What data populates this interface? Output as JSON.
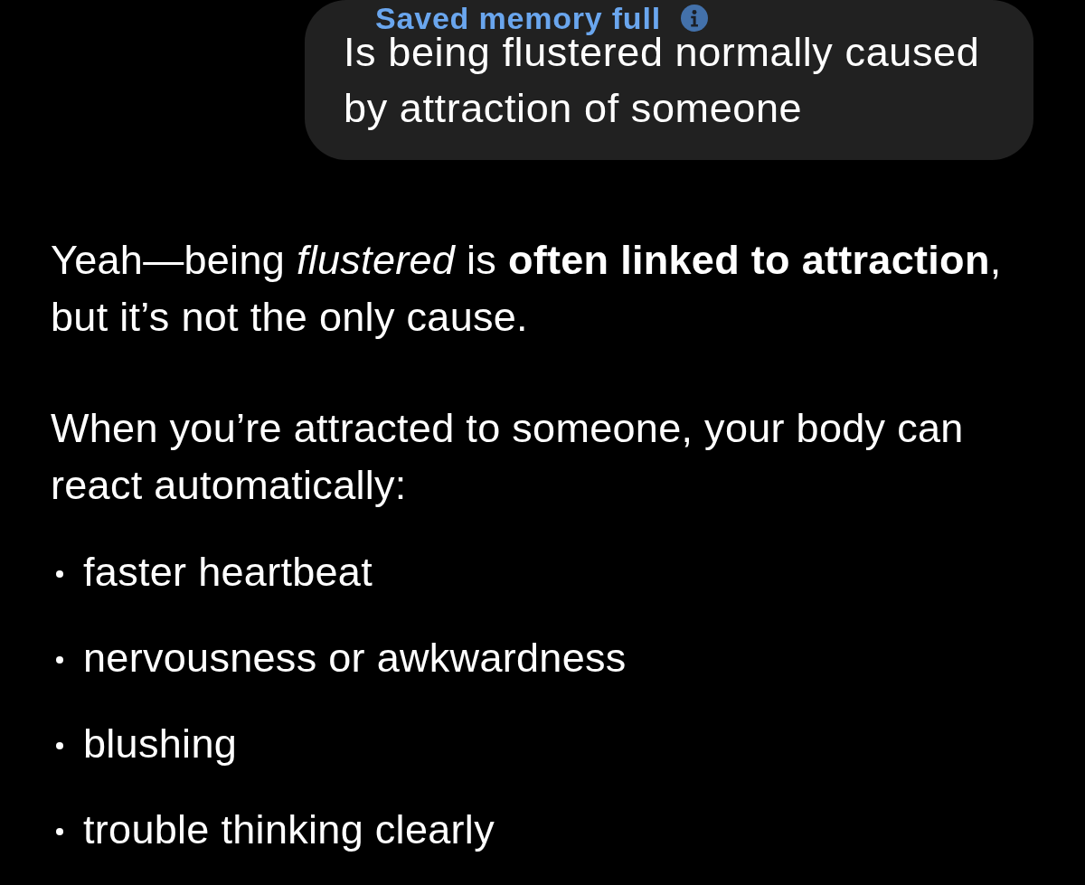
{
  "user_message": {
    "memory_notice": "Saved memory full",
    "text": "Is being flustered normally caused by attraction of someone"
  },
  "assistant_message": {
    "paragraphs": [
      "Yeah—being *flustered* is **often linked to attraction**, but it’s not the only cause.",
      "When you’re attracted to someone, your body can react automatically:"
    ],
    "bullets": [
      "faster heartbeat",
      "nervousness or awkwardness",
      "blushing",
      "trouble thinking clearly"
    ]
  }
}
